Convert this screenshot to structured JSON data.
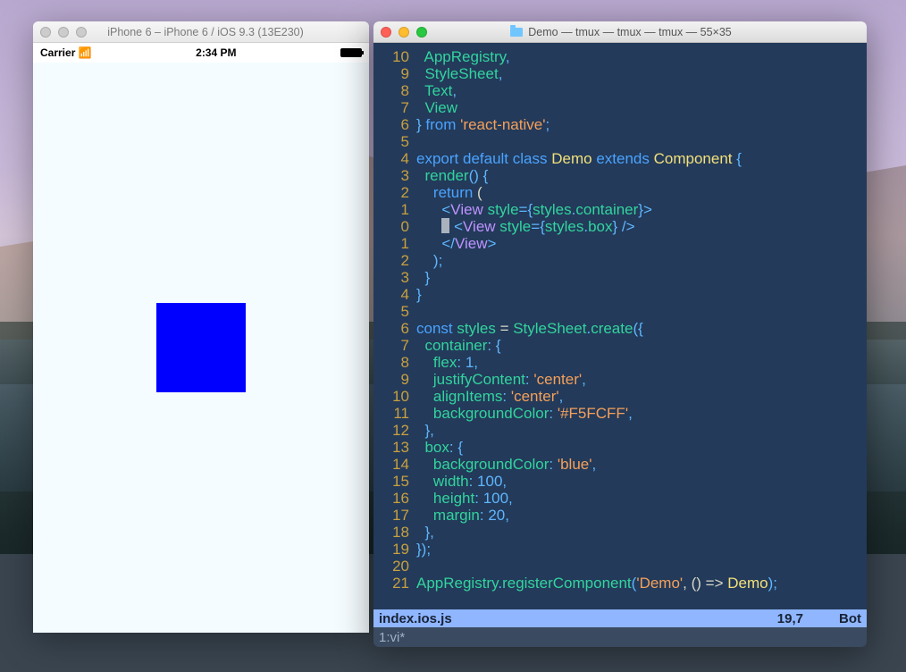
{
  "desktop": {},
  "simulator": {
    "window_title": "iPhone 6 – iPhone 6 / iOS 9.3 (13E230)",
    "status": {
      "carrier": "Carrier",
      "time": "2:34 PM"
    },
    "box_color": "#0000ff",
    "app_bg": "#F5FCFF"
  },
  "terminal": {
    "window_title": "Demo — tmux — tmux — tmux — 55×35",
    "status_line": {
      "filename": "index.ios.js",
      "pos": "19,7",
      "loc": "Bot"
    },
    "tmux_line": "1:vi*",
    "lines": [
      {
        "n": "10",
        "tokens": [
          {
            "t": "  "
          },
          {
            "t": "AppRegistry",
            "c": "id"
          },
          {
            "t": ",",
            "c": "punc"
          }
        ]
      },
      {
        "n": "9",
        "tokens": [
          {
            "t": "  "
          },
          {
            "t": "StyleSheet",
            "c": "id"
          },
          {
            "t": ",",
            "c": "punc"
          }
        ]
      },
      {
        "n": "8",
        "tokens": [
          {
            "t": "  "
          },
          {
            "t": "Text",
            "c": "id"
          },
          {
            "t": ",",
            "c": "punc"
          }
        ]
      },
      {
        "n": "7",
        "tokens": [
          {
            "t": "  "
          },
          {
            "t": "View",
            "c": "id"
          }
        ]
      },
      {
        "n": "6",
        "tokens": [
          {
            "t": "}",
            "c": "punc"
          },
          {
            "t": " "
          },
          {
            "t": "from",
            "c": "kw"
          },
          {
            "t": " "
          },
          {
            "t": "'react-native'",
            "c": "str"
          },
          {
            "t": ";",
            "c": "punc"
          }
        ]
      },
      {
        "n": "5",
        "tokens": []
      },
      {
        "n": "4",
        "tokens": [
          {
            "t": "export",
            "c": "kw"
          },
          {
            "t": " "
          },
          {
            "t": "default",
            "c": "kw"
          },
          {
            "t": " "
          },
          {
            "t": "class",
            "c": "kw"
          },
          {
            "t": " "
          },
          {
            "t": "Demo",
            "c": "classnm"
          },
          {
            "t": " "
          },
          {
            "t": "extends",
            "c": "kw"
          },
          {
            "t": " "
          },
          {
            "t": "Component",
            "c": "classnm"
          },
          {
            "t": " "
          },
          {
            "t": "{",
            "c": "punc"
          }
        ]
      },
      {
        "n": "3",
        "tokens": [
          {
            "t": "  "
          },
          {
            "t": "render",
            "c": "id"
          },
          {
            "t": "()",
            "c": "punc"
          },
          {
            "t": " "
          },
          {
            "t": "{",
            "c": "punc"
          }
        ]
      },
      {
        "n": "2",
        "tokens": [
          {
            "t": "    "
          },
          {
            "t": "return",
            "c": "kw"
          },
          {
            "t": " ("
          },
          {
            "t": "",
            "c": "punc"
          }
        ]
      },
      {
        "n": "1",
        "tokens": [
          {
            "t": "      "
          },
          {
            "t": "<",
            "c": "punc"
          },
          {
            "t": "View",
            "c": "tag"
          },
          {
            "t": " "
          },
          {
            "t": "style",
            "c": "attr"
          },
          {
            "t": "=",
            "c": "punc"
          },
          {
            "t": "{",
            "c": "punc"
          },
          {
            "t": "styles",
            "c": "id"
          },
          {
            "t": ".",
            "c": "dot"
          },
          {
            "t": "container",
            "c": "id"
          },
          {
            "t": "}",
            "c": "punc"
          },
          {
            "t": ">",
            "c": "punc"
          }
        ]
      },
      {
        "n": "0",
        "cursor": true,
        "tokens": [
          {
            "t": "      "
          },
          {
            "cursor": true
          },
          {
            "t": " "
          },
          {
            "t": "<",
            "c": "punc"
          },
          {
            "t": "View",
            "c": "tag"
          },
          {
            "t": " "
          },
          {
            "t": "style",
            "c": "attr"
          },
          {
            "t": "=",
            "c": "punc"
          },
          {
            "t": "{",
            "c": "punc"
          },
          {
            "t": "styles",
            "c": "id"
          },
          {
            "t": ".",
            "c": "dot"
          },
          {
            "t": "box",
            "c": "id"
          },
          {
            "t": "}",
            "c": "punc"
          },
          {
            "t": " />",
            "c": "punc"
          }
        ]
      },
      {
        "n": "1",
        "tokens": [
          {
            "t": "      "
          },
          {
            "t": "</",
            "c": "punc"
          },
          {
            "t": "View",
            "c": "tag"
          },
          {
            "t": ">",
            "c": "punc"
          }
        ]
      },
      {
        "n": "2",
        "tokens": [
          {
            "t": "    "
          },
          {
            "t": ");",
            "c": "punc"
          }
        ]
      },
      {
        "n": "3",
        "tokens": [
          {
            "t": "  "
          },
          {
            "t": "}",
            "c": "punc"
          }
        ]
      },
      {
        "n": "4",
        "tokens": [
          {
            "t": "}",
            "c": "punc"
          }
        ]
      },
      {
        "n": "5",
        "tokens": []
      },
      {
        "n": "6",
        "tokens": [
          {
            "t": "const",
            "c": "kw"
          },
          {
            "t": " "
          },
          {
            "t": "styles",
            "c": "id"
          },
          {
            "t": " = "
          },
          {
            "t": "StyleSheet",
            "c": "id"
          },
          {
            "t": ".",
            "c": "dot"
          },
          {
            "t": "create",
            "c": "id"
          },
          {
            "t": "({",
            "c": "punc"
          }
        ]
      },
      {
        "n": "7",
        "tokens": [
          {
            "t": "  "
          },
          {
            "t": "container",
            "c": "id"
          },
          {
            "t": ":",
            "c": "punc"
          },
          {
            "t": " "
          },
          {
            "t": "{",
            "c": "punc"
          }
        ]
      },
      {
        "n": "8",
        "tokens": [
          {
            "t": "    "
          },
          {
            "t": "flex",
            "c": "id"
          },
          {
            "t": ":",
            "c": "punc"
          },
          {
            "t": " 1,",
            "c": "punc"
          }
        ]
      },
      {
        "n": "9",
        "tokens": [
          {
            "t": "    "
          },
          {
            "t": "justifyContent",
            "c": "id"
          },
          {
            "t": ":",
            "c": "punc"
          },
          {
            "t": " "
          },
          {
            "t": "'center'",
            "c": "str"
          },
          {
            "t": ",",
            "c": "punc"
          }
        ]
      },
      {
        "n": "10",
        "tokens": [
          {
            "t": "    "
          },
          {
            "t": "alignItems",
            "c": "id"
          },
          {
            "t": ":",
            "c": "punc"
          },
          {
            "t": " "
          },
          {
            "t": "'center'",
            "c": "str"
          },
          {
            "t": ",",
            "c": "punc"
          }
        ]
      },
      {
        "n": "11",
        "tokens": [
          {
            "t": "    "
          },
          {
            "t": "backgroundColor",
            "c": "id"
          },
          {
            "t": ":",
            "c": "punc"
          },
          {
            "t": " "
          },
          {
            "t": "'#F5FCFF'",
            "c": "str"
          },
          {
            "t": ",",
            "c": "punc"
          }
        ]
      },
      {
        "n": "12",
        "tokens": [
          {
            "t": "  "
          },
          {
            "t": "},",
            "c": "punc"
          }
        ]
      },
      {
        "n": "13",
        "tokens": [
          {
            "t": "  "
          },
          {
            "t": "box",
            "c": "id"
          },
          {
            "t": ":",
            "c": "punc"
          },
          {
            "t": " "
          },
          {
            "t": "{",
            "c": "punc"
          }
        ]
      },
      {
        "n": "14",
        "tokens": [
          {
            "t": "    "
          },
          {
            "t": "backgroundColor",
            "c": "id"
          },
          {
            "t": ":",
            "c": "punc"
          },
          {
            "t": " "
          },
          {
            "t": "'blue'",
            "c": "str"
          },
          {
            "t": ",",
            "c": "punc"
          }
        ]
      },
      {
        "n": "15",
        "tokens": [
          {
            "t": "    "
          },
          {
            "t": "width",
            "c": "id"
          },
          {
            "t": ":",
            "c": "punc"
          },
          {
            "t": " 100,",
            "c": "punc"
          }
        ]
      },
      {
        "n": "16",
        "tokens": [
          {
            "t": "    "
          },
          {
            "t": "height",
            "c": "id"
          },
          {
            "t": ":",
            "c": "punc"
          },
          {
            "t": " 100,",
            "c": "punc"
          }
        ]
      },
      {
        "n": "17",
        "tokens": [
          {
            "t": "    "
          },
          {
            "t": "margin",
            "c": "id"
          },
          {
            "t": ":",
            "c": "punc"
          },
          {
            "t": " 20,",
            "c": "punc"
          }
        ]
      },
      {
        "n": "18",
        "tokens": [
          {
            "t": "  "
          },
          {
            "t": "},",
            "c": "punc"
          }
        ]
      },
      {
        "n": "19",
        "tokens": [
          {
            "t": "});",
            "c": "punc"
          }
        ]
      },
      {
        "n": "20",
        "tokens": []
      },
      {
        "n": "21",
        "tokens": [
          {
            "t": "AppRegistry",
            "c": "id"
          },
          {
            "t": ".",
            "c": "dot"
          },
          {
            "t": "registerComponent",
            "c": "id"
          },
          {
            "t": "(",
            "c": "punc"
          },
          {
            "t": "'Demo'",
            "c": "str"
          },
          {
            "t": ", () => "
          },
          {
            "t": "Demo",
            "c": "classnm"
          },
          {
            "t": ");",
            "c": "punc"
          }
        ]
      }
    ]
  }
}
